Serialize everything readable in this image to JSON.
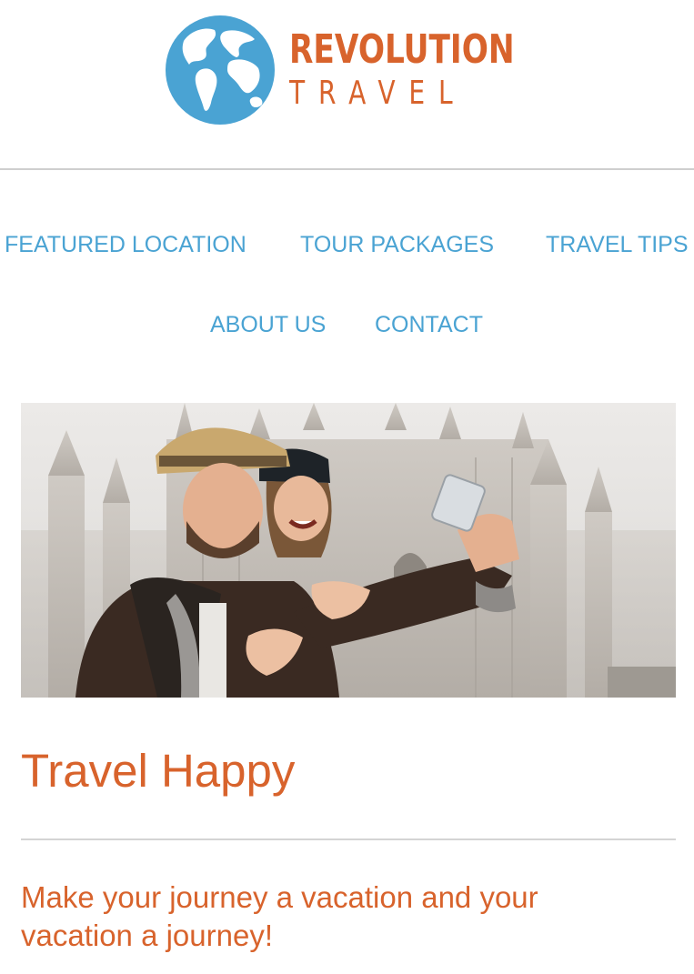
{
  "brand": {
    "name_line1": "REVOLUTION",
    "name_line2": "TRAVEL",
    "logo_icon": "globe-icon",
    "accent_color": "#d8632c",
    "globe_color": "#4aa3d3"
  },
  "nav": {
    "link_color": "#4aa3d3",
    "items": [
      {
        "label": "FEATURED LOCATION"
      },
      {
        "label": "TOUR PACKAGES"
      },
      {
        "label": "TRAVEL TIPS"
      },
      {
        "label": "ABOUT US"
      },
      {
        "label": "CONTACT"
      }
    ]
  },
  "hero": {
    "image_subject": "couple-selfie-in-front-of-cathedral"
  },
  "main": {
    "title": "Travel Happy",
    "tagline": "Make your journey a vacation and your vacation a journey!"
  }
}
